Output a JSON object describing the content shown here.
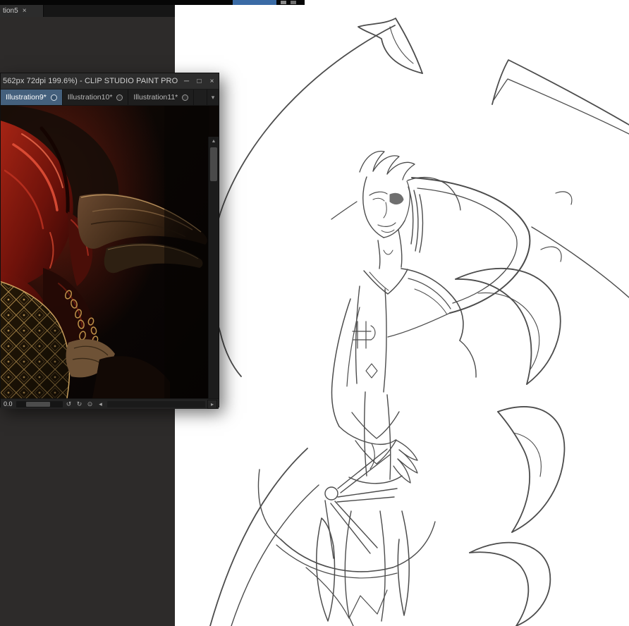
{
  "background_window": {
    "document_tab": {
      "label": "tion5"
    }
  },
  "floating_window": {
    "title": "562px 72dpi 199.6%)  - CLIP STUDIO PAINT PRO",
    "tabs": [
      {
        "label": "Illustration9*"
      },
      {
        "label": "Illustration10*"
      },
      {
        "label": "Illustration11*"
      }
    ],
    "statusbar": {
      "rotation_value": "0.0"
    }
  },
  "icons": {
    "close": "×",
    "minimize": "─",
    "maximize": "□",
    "tab_close": "×",
    "tab_overflow": "▾",
    "scroll_up": "▲",
    "scroll_down": "▼",
    "scroll_left": "◂",
    "scroll_right": "▸",
    "rotate_left": "↺",
    "rotate_right": "↻",
    "reset_view": "⊙",
    "flip_view": "◇"
  },
  "colors": {
    "accent_tab_active": "#44607d",
    "pasteboard": "#2d2b2a",
    "titlebar": "#2d2d2d",
    "top_fragment_blue": "#3a6ba5",
    "canvas": "#ffffff"
  }
}
